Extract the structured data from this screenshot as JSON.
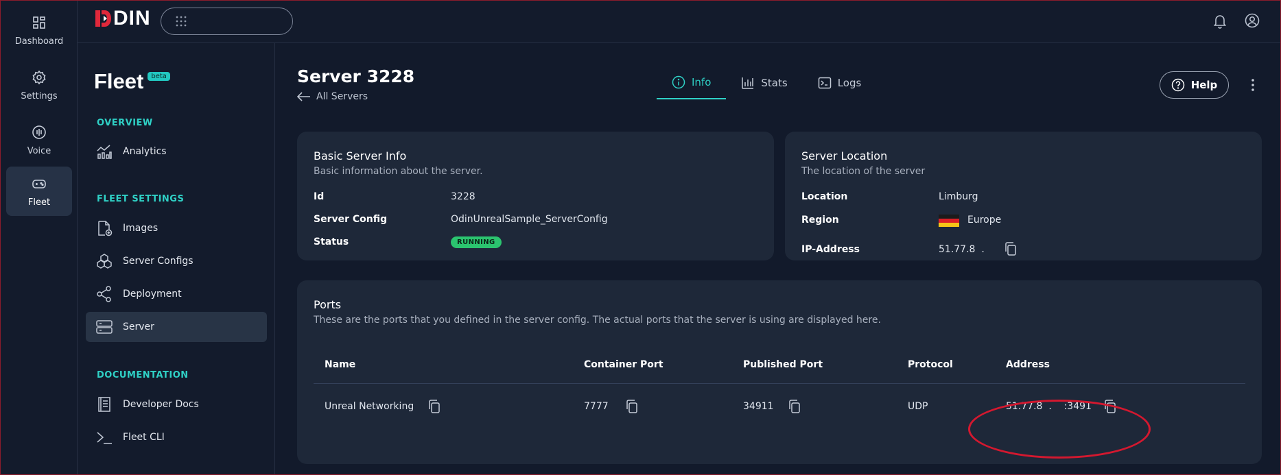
{
  "rail": {
    "items": [
      {
        "label": "Dashboard",
        "icon": "dashboard-icon"
      },
      {
        "label": "Settings",
        "icon": "gear-icon"
      },
      {
        "label": "Voice",
        "icon": "voice-icon"
      },
      {
        "label": "Fleet",
        "icon": "gamepad-icon",
        "active": true
      }
    ]
  },
  "topbar": {
    "logo_text": "DIN",
    "search": {
      "placeholder": ""
    }
  },
  "sidebar": {
    "brand": "Fleet",
    "beta": "beta",
    "overview_label": "OVERVIEW",
    "fleet_settings_label": "FLEET SETTINGS",
    "documentation_label": "DOCUMENTATION",
    "items": {
      "analytics": "Analytics",
      "images": "Images",
      "server_configs": "Server Configs",
      "deployment": "Deployment",
      "server": "Server",
      "developer_docs": "Developer Docs",
      "fleet_cli": "Fleet CLI"
    }
  },
  "main": {
    "title": "Server 3228",
    "back": "All Servers",
    "tabs": {
      "info": "Info",
      "stats": "Stats",
      "logs": "Logs"
    },
    "help": "Help"
  },
  "basic_info": {
    "title": "Basic Server Info",
    "subtitle": "Basic information about the server.",
    "id_label": "Id",
    "id_value": "3228",
    "config_label": "Server Config",
    "config_value": "OdinUnrealSample_ServerConfig",
    "status_label": "Status",
    "status_value": "RUNNING"
  },
  "location": {
    "title": "Server Location",
    "subtitle": "The location of the server",
    "location_label": "Location",
    "location_value": "Limburg",
    "region_label": "Region",
    "region_value": "Europe",
    "ip_label": "IP-Address",
    "ip_value": "51.77.8  ."
  },
  "ports": {
    "title": "Ports",
    "subtitle": "These are the ports that you defined in the server config. The actual ports that the server is using are displayed here.",
    "headers": {
      "name": "Name",
      "container": "Container Port",
      "published": "Published Port",
      "protocol": "Protocol",
      "address": "Address"
    },
    "row": {
      "name": "Unreal Networking",
      "container": "7777",
      "published": "34911",
      "protocol": "UDP",
      "address": "51.77.8  .    :3491"
    }
  },
  "colors": {
    "accent": "#2fd1c6",
    "running": "#2bc46f",
    "annotation": "#d4182f"
  }
}
